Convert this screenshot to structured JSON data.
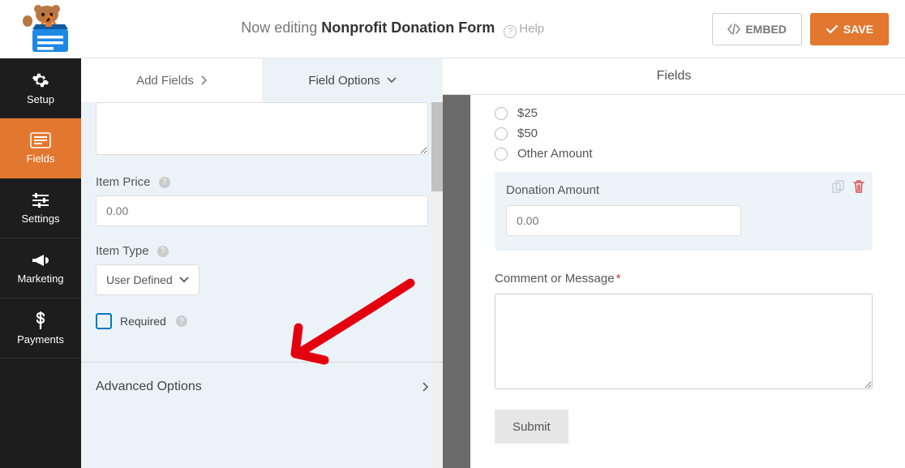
{
  "topbar": {
    "editing_prefix": "Now editing ",
    "form_name": "Nonprofit Donation Form",
    "help_label": "Help",
    "embed_label": "EMBED",
    "save_label": "SAVE"
  },
  "nav": {
    "setup": "Setup",
    "fields": "Fields",
    "settings": "Settings",
    "marketing": "Marketing",
    "payments": "Payments"
  },
  "panel": {
    "header": "Fields",
    "tab_add": "Add Fields",
    "tab_options": "Field Options",
    "item_price_label": "Item Price",
    "item_price_placeholder": "0.00",
    "item_type_label": "Item Type",
    "item_type_value": "User Defined",
    "required_label": "Required",
    "advanced_label": "Advanced Options"
  },
  "preview": {
    "radio_25": "$25",
    "radio_50": "$50",
    "radio_other": "Other Amount",
    "donation_label": "Donation Amount",
    "donation_placeholder": "0.00",
    "comment_label": "Comment or Message",
    "submit_label": "Submit"
  }
}
